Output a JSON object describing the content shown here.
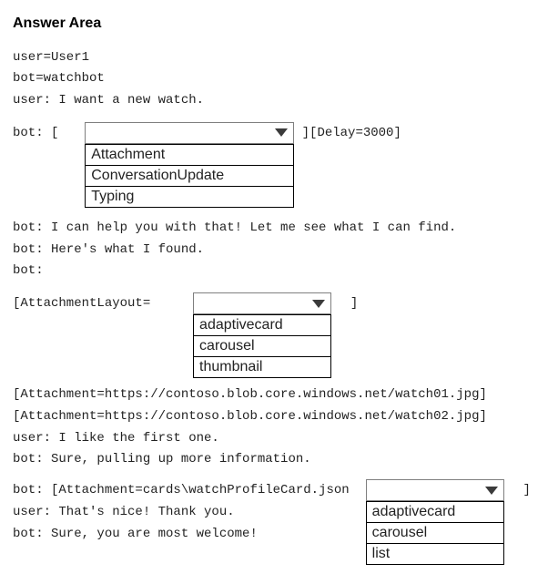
{
  "title": "Answer Area",
  "lines": {
    "userDecl": "user=User1",
    "botDecl": "bot=watchbot",
    "u_want": "user: I want a new watch.",
    "bot_open": "bot: [",
    "delay": "][Delay=3000]",
    "bot_help": "bot: I can help you with that! Let me see what I can find.",
    "bot_found": "bot: Here's what I found.",
    "bot_empty": "bot:",
    "attach_layout_open": "[AttachmentLayout=",
    "close_bracket": "]",
    "attach1": "[Attachment=https://contoso.blob.core.windows.net/watch01.jpg]",
    "attach2": "[Attachment=https://contoso.blob.core.windows.net/watch02.jpg]",
    "u_like": "user: I like the first one.",
    "bot_pull": "bot: Sure, pulling up more information.",
    "bot_card": "bot: [Attachment=cards\\watchProfileCard.json",
    "close_bracket2": "]",
    "u_thanks": "user: That's nice! Thank you.",
    "bot_welcome": "bot: Sure, you are most welcome!"
  },
  "select1": {
    "options": [
      "Attachment",
      "ConversationUpdate",
      "Typing"
    ]
  },
  "select2": {
    "options": [
      "adaptivecard",
      "carousel",
      "thumbnail"
    ]
  },
  "select3": {
    "options": [
      "adaptivecard",
      "carousel",
      "list"
    ]
  }
}
